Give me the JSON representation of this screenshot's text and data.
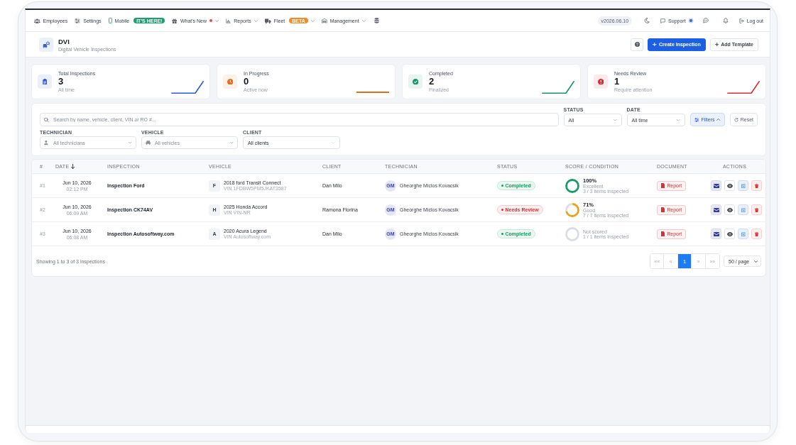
{
  "nav": {
    "items": [
      {
        "label": "Employees",
        "has_menu": false,
        "notification": false
      },
      {
        "label": "Settings",
        "has_menu": false,
        "notification": false
      },
      {
        "label": "Mobile",
        "has_menu": false,
        "notification": false,
        "badge": {
          "text": "IT'S HERE!",
          "color": "#1f9d6e"
        }
      },
      {
        "label": "What's New",
        "has_menu": true,
        "notification": true
      },
      {
        "label": "Reports",
        "has_menu": true,
        "notification": false
      },
      {
        "label": "Fleet",
        "has_menu": true,
        "notification": false,
        "badge": {
          "text": "BETA",
          "color": "#f28c28"
        }
      },
      {
        "label": "Management",
        "has_menu": true,
        "notification": false
      }
    ],
    "version": "v2026.06.10",
    "support": {
      "label": "Support",
      "notification": true
    },
    "logout": "Log out"
  },
  "header": {
    "title": "DVI",
    "subtitle": "Digital Vehicle Inspections",
    "buttons": [
      {
        "label": "Create Inspection",
        "kind": "primary"
      },
      {
        "label": "Add Template",
        "kind": "secondary"
      }
    ]
  },
  "stats": [
    {
      "label": "Total Inspections",
      "value": "3",
      "caption": "All time",
      "color": "#2f5bd3",
      "kind": "rising"
    },
    {
      "label": "In Progress",
      "value": "0",
      "caption": "Active now",
      "color": "#e0701f",
      "kind": "flat"
    },
    {
      "label": "Completed",
      "value": "2",
      "caption": "Finalized",
      "color": "#17936a",
      "kind": "rising"
    },
    {
      "label": "Needs Review",
      "value": "1",
      "caption": "Require attention",
      "color": "#d32f34",
      "kind": "rising"
    }
  ],
  "filters": {
    "search": {
      "placeholder": "Search by name, vehicle, client, VIN or RO #..."
    },
    "status": {
      "label": "STATUS",
      "value": "All"
    },
    "date": {
      "label": "DATE",
      "value": "All time"
    },
    "filters_button": {
      "label": "Filters",
      "expanded": true
    },
    "reset": "Reset",
    "technician": {
      "label": "TECHNICIAN",
      "placeholder": "All technicians"
    },
    "vehicle": {
      "label": "VEHICLE",
      "placeholder": "All vehicles"
    },
    "client": {
      "label": "CLIENT",
      "value": "All clients"
    }
  },
  "table": {
    "columns": [
      {
        "label": "#",
        "sorted": false
      },
      {
        "label": "DATE",
        "sorted": true
      },
      {
        "label": "INSPECTION",
        "sorted": false
      },
      {
        "label": "VEHICLE",
        "sorted": false
      },
      {
        "label": "CLIENT",
        "sorted": false
      },
      {
        "label": "TECHNICIAN",
        "sorted": false
      },
      {
        "label": "STATUS",
        "sorted": false
      },
      {
        "label": "SCORE / CONDITION",
        "sorted": false
      },
      {
        "label": "DOCUMENT",
        "sorted": false
      },
      {
        "label": "ACTIONS",
        "sorted": false
      }
    ],
    "rows": [
      {
        "number": "#1",
        "date": "Jun 10, 2026",
        "time": "02:12 PM",
        "inspection": "Inspection Ford",
        "vehicle": {
          "initial": "F",
          "name": "2018 ford Transit Connect",
          "vin": "VIN 1FDBW5PM5JKAT3587"
        },
        "client": "Dan Milo",
        "technician": {
          "initials": "GM",
          "name": "Gheorghe Miclos Kovacsik"
        },
        "status": {
          "label": "Completed",
          "kind": "completed"
        },
        "score": {
          "percent": "100%",
          "condition": "Excellent",
          "items": "3 / 3 items inspected",
          "level": 1,
          "color": "#1e9a6a"
        },
        "document": "Report"
      },
      {
        "number": "#2",
        "date": "Jun 10, 2026",
        "time": "06:09 AM",
        "inspection": "Inspection CK74AV",
        "vehicle": {
          "initial": "H",
          "name": "2025 Honda Accord",
          "vin": "VIN VIN-NR"
        },
        "client": "Ramona Florina",
        "technician": {
          "initials": "GM",
          "name": "Gheorghe Miclos Kovacsik"
        },
        "status": {
          "label": "Needs Review",
          "kind": "needs_review"
        },
        "score": {
          "percent": "71%",
          "condition": "Good",
          "items": "7 / 7 items inspected",
          "level": 0.71,
          "color": "#e9a21c"
        },
        "document": "Report"
      },
      {
        "number": "#3",
        "date": "Jun 10, 2026",
        "time": "06:08 AM",
        "inspection": "Inspection Autosoftway.com",
        "vehicle": {
          "initial": "A",
          "name": "2020 Acura Legend",
          "vin": "VIN Autosoftway.com"
        },
        "client": "Dan Milo",
        "technician": {
          "initials": "GM",
          "name": "Gheorghe Miclos Kovacsik"
        },
        "status": {
          "label": "Completed",
          "kind": "completed"
        },
        "score": {
          "condition": "Not scored",
          "items": "1 / 1 items inspected",
          "level": 0
        },
        "document": "Report"
      }
    ],
    "footer": "Showing 1 to 3 of 3 inspections",
    "pagination": [
      {
        "label": "««",
        "selected": false,
        "disabled": true
      },
      {
        "label": "«",
        "selected": false,
        "disabled": true
      },
      {
        "label": "1",
        "selected": true,
        "disabled": false
      },
      {
        "label": "»",
        "selected": false,
        "disabled": true
      },
      {
        "label": "»»",
        "selected": false,
        "disabled": true
      }
    ],
    "page_size": "50 / page"
  }
}
